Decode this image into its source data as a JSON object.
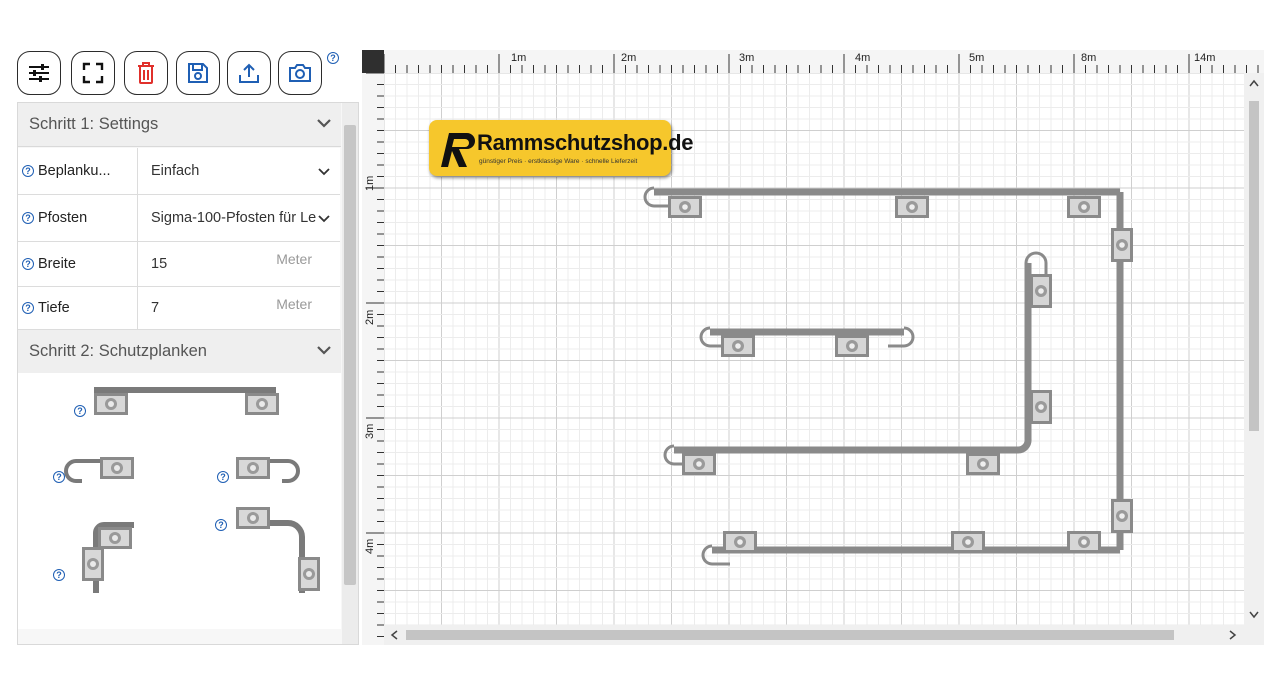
{
  "toolbar": {
    "buttons": [
      {
        "name": "settings-button",
        "icon": "sliders-icon"
      },
      {
        "name": "fullscreen-button",
        "icon": "fullscreen-icon"
      },
      {
        "name": "delete-button",
        "icon": "trash-icon",
        "color": "#e0302b"
      },
      {
        "name": "save-button",
        "icon": "floppy-icon",
        "color": "#1f5fb4"
      },
      {
        "name": "export-button",
        "icon": "upload-icon",
        "color": "#1f5fb4"
      },
      {
        "name": "screenshot-button",
        "icon": "camera-icon",
        "color": "#1f5fb4"
      }
    ],
    "help_glyph": "?"
  },
  "step1": {
    "title": "Schritt 1: Settings",
    "fields": [
      {
        "label": "Beplanku...",
        "value": "Einfach",
        "type": "select"
      },
      {
        "label": "Pfosten",
        "value": "Sigma-100-Pfosten für Le",
        "type": "select"
      },
      {
        "label": "Breite",
        "value": "15",
        "unit": "Meter",
        "type": "number"
      },
      {
        "label": "Tiefe",
        "value": "7",
        "unit": "Meter",
        "type": "number"
      }
    ]
  },
  "step2": {
    "title": "Schritt 2: Schutzplanken"
  },
  "canvas": {
    "ruler_top": [
      "1m",
      "2m",
      "3m",
      "4m",
      "5m",
      "8m",
      "14m"
    ],
    "ruler_left": [
      "1m",
      "2m",
      "3m",
      "4m"
    ],
    "logo": {
      "text": "Rammschutzshop.de",
      "tagline": "günstiger Preis · erstklassige Ware · schnelle Lieferzeit",
      "bg": "#f6c72c"
    }
  },
  "colors": {
    "accent": "#1f5fb4",
    "danger": "#e0302b",
    "frame": "#2f2f2f"
  }
}
